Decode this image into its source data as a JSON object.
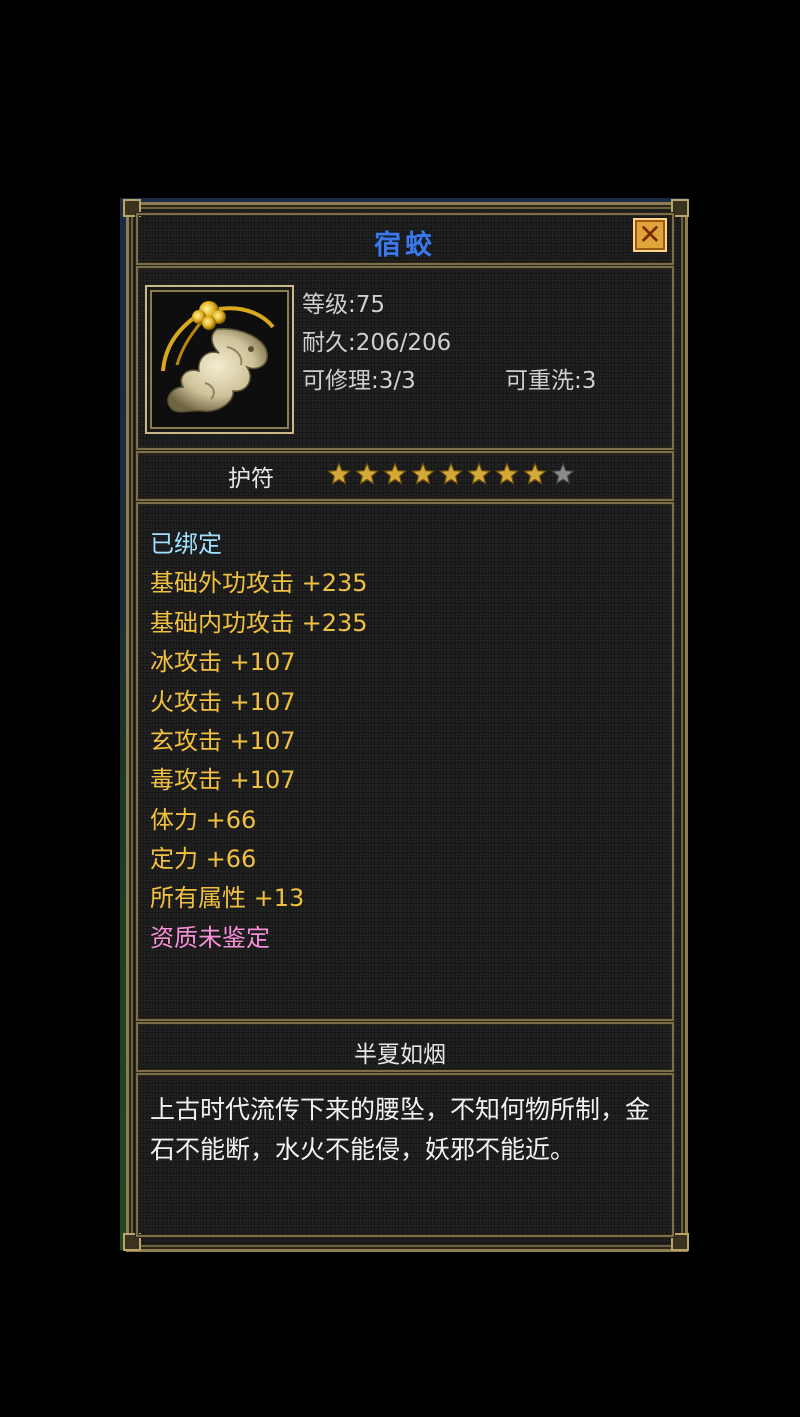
{
  "item": {
    "name": "宿蛟",
    "close_glyph": "✕",
    "icon": "jade-pendant-icon",
    "stats": {
      "level": "等级:75",
      "durability": "耐久:206/206",
      "repair": "可修理:3/3",
      "rewash": "可重洗:3"
    },
    "type": "护符",
    "stars": {
      "filled": 8,
      "total": 9
    },
    "attributes": {
      "bound": "已绑定",
      "lines": [
        "基础外功攻击 +235",
        "基础内功攻击 +235",
        "冰攻击 +107",
        "火攻击 +107",
        "玄攻击 +107",
        "毒攻击 +107",
        "体力 +66",
        "定力 +66",
        "所有属性 +13"
      ],
      "unidentified": "资质未鉴定"
    },
    "maker": "半夏如烟",
    "description": "上古时代流传下来的腰坠，不知何物所制，金石不能断，水火不能侵，妖邪不能近。"
  },
  "colors": {
    "title": "#3c78e6",
    "attribute": "#f0c040",
    "bound": "#9fe0ff",
    "unidentified": "#f58fd8",
    "star_filled": "#d4a93a",
    "star_empty": "#8a8a8a"
  }
}
